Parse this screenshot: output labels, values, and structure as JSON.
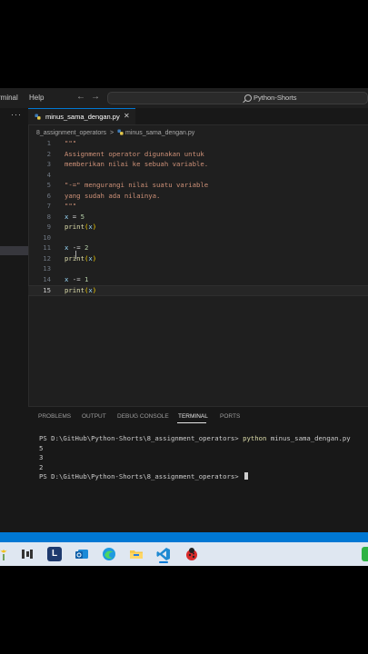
{
  "menu": {
    "terminal": "rminal",
    "help": "Help"
  },
  "nav": {
    "back": "←",
    "forward": "→"
  },
  "search": {
    "text": "Python-Shorts"
  },
  "sidebar": {
    "more": "···"
  },
  "tab": {
    "label": "minus_sama_dengan.py",
    "close": "✕"
  },
  "breadcrumb": {
    "folder": "8_assignment_operators",
    "sep": ">",
    "file": "minus_sama_dengan.py"
  },
  "code": {
    "l1": "\"\"\"",
    "l2": "Assignment operator digunakan untuk",
    "l3": "memberikan nilai ke sebuah variable.",
    "l5": "\"-=\" mengurangi nilai suatu variable",
    "l6": "yang sudah ada nilainya.",
    "l7": "\"\"\"",
    "l8_var": "x",
    "l8_op": " = ",
    "l8_num": "5",
    "l9_fn": "print",
    "l9_open": "(",
    "l9_var": "x",
    "l9_close": ")",
    "l11_var": "x",
    "l11_op": " -= ",
    "l11_num": "2",
    "l12_fn": "print",
    "l12_open": "(",
    "l12_var": "x",
    "l12_close": ")",
    "l14_var": "x",
    "l14_op": " -= ",
    "l14_num": "1",
    "l15_fn": "print",
    "l15_open": "(",
    "l15_var": "x",
    "l15_close": ")"
  },
  "line_numbers": [
    "1",
    "2",
    "3",
    "4",
    "5",
    "6",
    "7",
    "8",
    "9",
    "10",
    "11",
    "12",
    "13",
    "14",
    "15"
  ],
  "panel": {
    "tabs": [
      "PROBLEMS",
      "OUTPUT",
      "DEBUG CONSOLE",
      "TERMINAL",
      "PORTS"
    ],
    "terminal": {
      "prompt": "PS D:\\GitHub\\Python-Shorts\\8_assignment_operators> ",
      "command": "python",
      "args": " minus_sama_dengan.py",
      "out1": "5",
      "out2": "3",
      "out3": "2"
    }
  },
  "taskbar": {
    "l_icon": "L"
  },
  "colors": {
    "accent": "#0078d4",
    "editor_bg": "#1f1f1f",
    "string": "#ce9178",
    "variable": "#9cdcfe",
    "function": "#dcdcaa"
  }
}
